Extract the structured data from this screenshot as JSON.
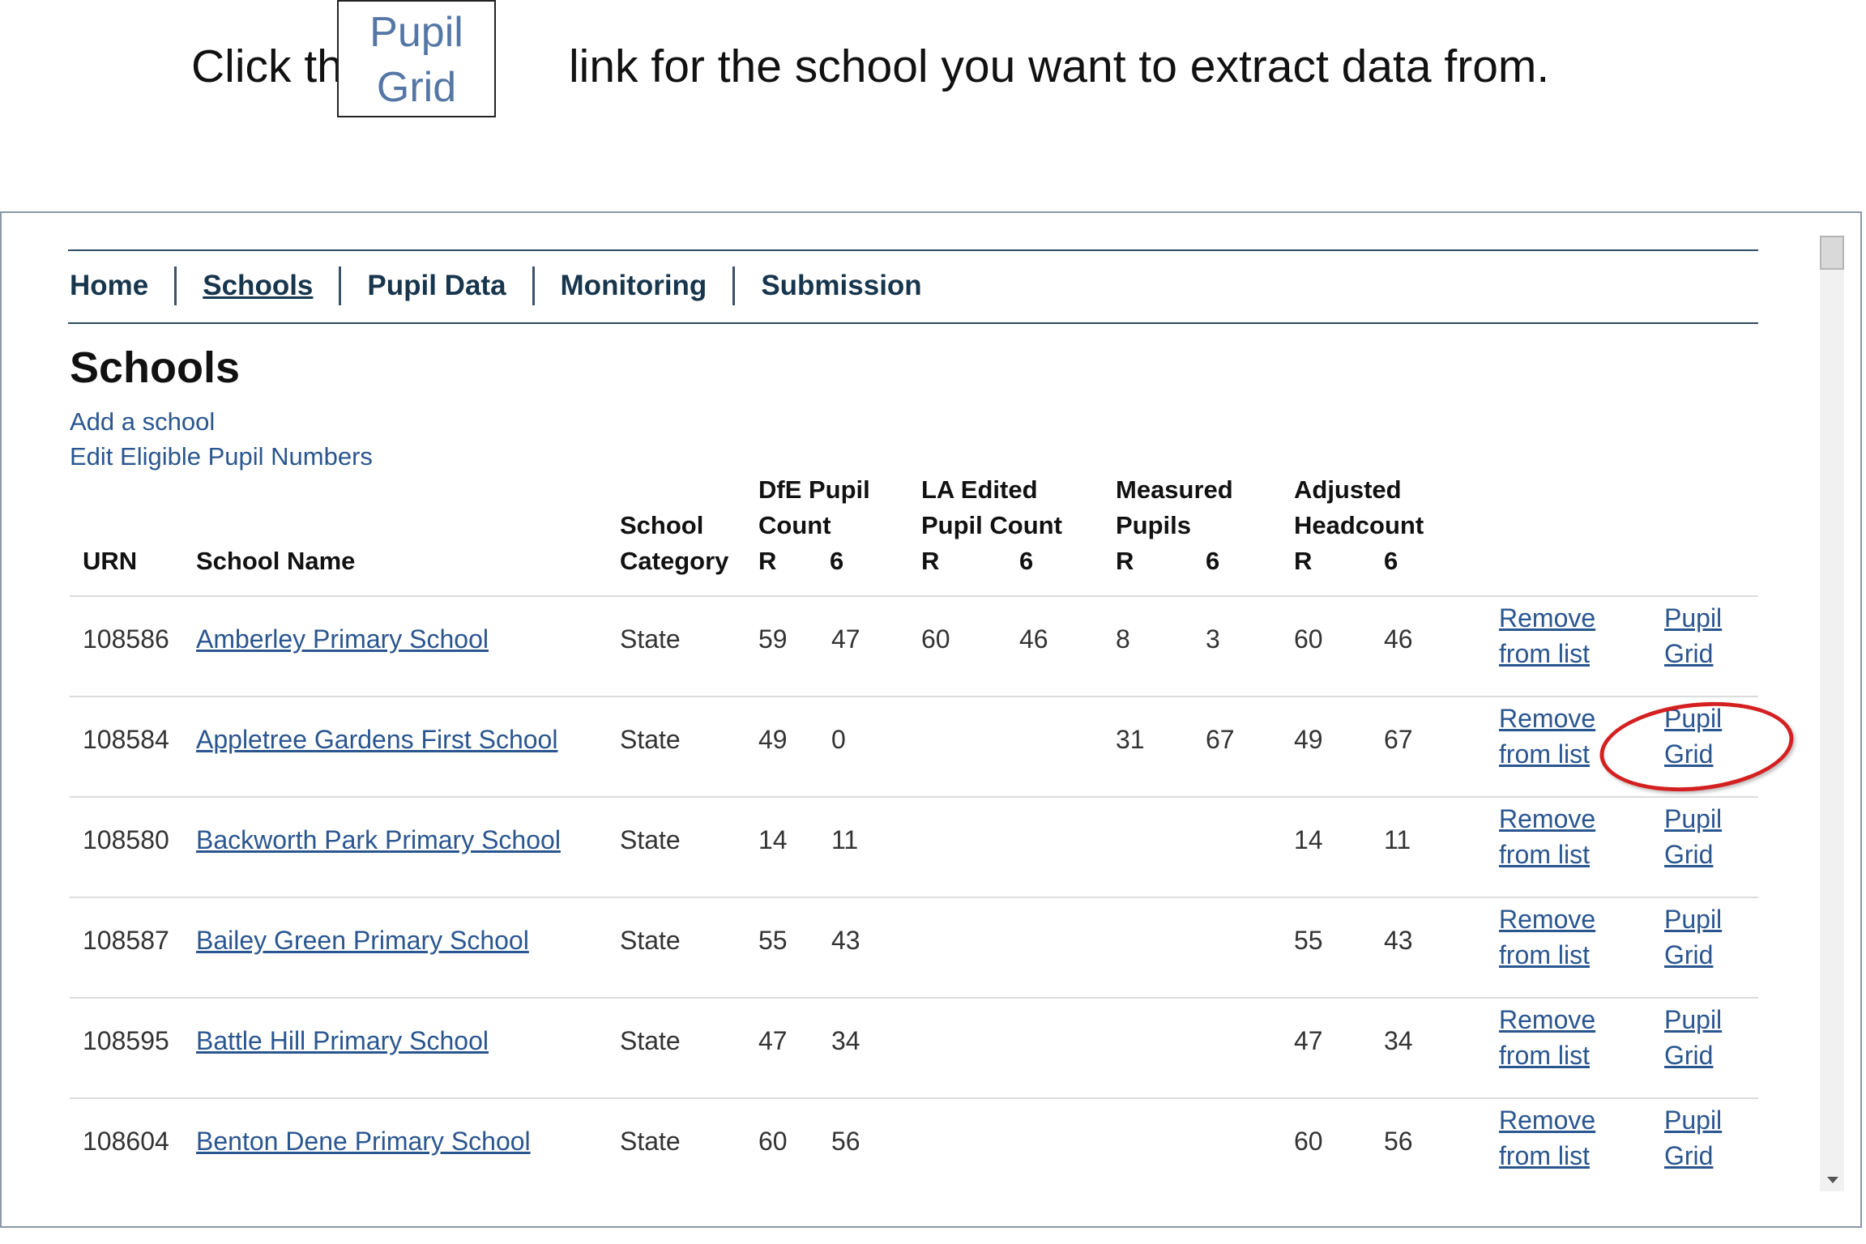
{
  "instruction": {
    "prefix": "Click th",
    "callout_line1": "Pupil",
    "callout_line2": "Grid",
    "suffix": "link for the school you want to extract data from."
  },
  "nav": {
    "items": [
      {
        "label": "Home",
        "active": false
      },
      {
        "label": "Schools",
        "active": true
      },
      {
        "label": "Pupil Data",
        "active": false
      },
      {
        "label": "Monitoring",
        "active": false
      },
      {
        "label": "Submission",
        "active": false
      }
    ]
  },
  "page": {
    "title": "Schools",
    "add_link": "Add a school",
    "edit_link": "Edit Eligible Pupil Numbers"
  },
  "table": {
    "headers": {
      "urn": "URN",
      "school_name": "School Name",
      "school_category_1": "School",
      "school_category_2": "Category",
      "dfe_1": "DfE Pupil",
      "dfe_2": "Count",
      "la_1": "LA Edited",
      "la_2": "Pupil Count",
      "measured_1": "Measured",
      "measured_2": "Pupils",
      "adjusted_1": "Adjusted",
      "adjusted_2": "Headcount",
      "sub_r": "R",
      "sub_6": "6"
    },
    "rows": [
      {
        "urn": "108586",
        "name": "Amberley Primary School",
        "category": "State",
        "dfe_r": "59",
        "dfe_6": "47",
        "la_r": "60",
        "la_6": "46",
        "mp_r": "8",
        "mp_6": "3",
        "ah_r": "60",
        "ah_6": "46"
      },
      {
        "urn": "108584",
        "name": "Appletree Gardens First School",
        "category": "State",
        "dfe_r": "49",
        "dfe_6": "0",
        "la_r": "",
        "la_6": "",
        "mp_r": "31",
        "mp_6": "67",
        "ah_r": "49",
        "ah_6": "67"
      },
      {
        "urn": "108580",
        "name": "Backworth Park Primary School",
        "category": "State",
        "dfe_r": "14",
        "dfe_6": "11",
        "la_r": "",
        "la_6": "",
        "mp_r": "",
        "mp_6": "",
        "ah_r": "14",
        "ah_6": "11"
      },
      {
        "urn": "108587",
        "name": "Bailey Green Primary School",
        "category": "State",
        "dfe_r": "55",
        "dfe_6": "43",
        "la_r": "",
        "la_6": "",
        "mp_r": "",
        "mp_6": "",
        "ah_r": "55",
        "ah_6": "43"
      },
      {
        "urn": "108595",
        "name": "Battle Hill Primary School",
        "category": "State",
        "dfe_r": "47",
        "dfe_6": "34",
        "la_r": "",
        "la_6": "",
        "mp_r": "",
        "mp_6": "",
        "ah_r": "47",
        "ah_6": "34"
      },
      {
        "urn": "108604",
        "name": "Benton Dene Primary School",
        "category": "State",
        "dfe_r": "60",
        "dfe_6": "56",
        "la_r": "",
        "la_6": "",
        "mp_r": "",
        "mp_6": "",
        "ah_r": "60",
        "ah_6": "56"
      }
    ],
    "actions": {
      "remove_1": "Remove",
      "remove_2": "from list",
      "grid_1": "Pupil",
      "grid_2": "Grid"
    }
  },
  "colors": {
    "link": "#2a5690",
    "nav_text": "#17364d",
    "highlight": "#d42020"
  }
}
